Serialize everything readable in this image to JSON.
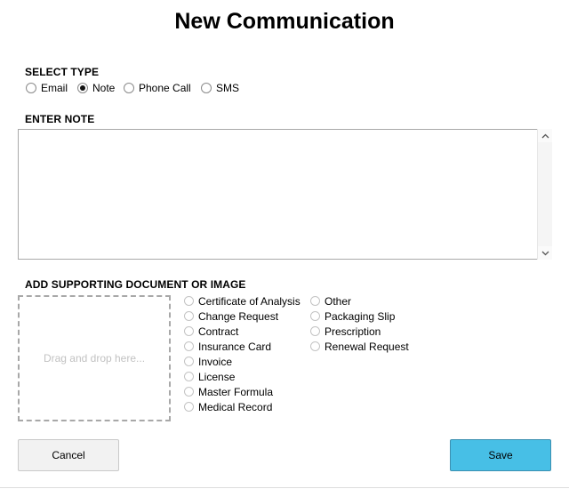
{
  "title": "New Communication",
  "select_type": {
    "label": "SELECT TYPE",
    "options": [
      {
        "label": "Email",
        "checked": false
      },
      {
        "label": "Note",
        "checked": true
      },
      {
        "label": "Phone Call",
        "checked": false
      },
      {
        "label": "SMS",
        "checked": false
      }
    ]
  },
  "note": {
    "label": "ENTER NOTE",
    "value": ""
  },
  "attachment": {
    "label": "ADD SUPPORTING DOCUMENT OR IMAGE",
    "dropzone_text": "Drag and drop here...",
    "doc_types_col1": [
      "Certificate of Analysis",
      "Change Request",
      "Contract",
      "Insurance Card",
      "Invoice",
      "License",
      "Master Formula",
      "Medical Record"
    ],
    "doc_types_col2": [
      "Other",
      "Packaging Slip",
      "Prescription",
      "Renewal Request"
    ]
  },
  "actions": {
    "cancel_label": "Cancel",
    "save_label": "Save"
  },
  "colors": {
    "save_button": "#47bfe6",
    "cancel_button": "#f2f2f2"
  }
}
